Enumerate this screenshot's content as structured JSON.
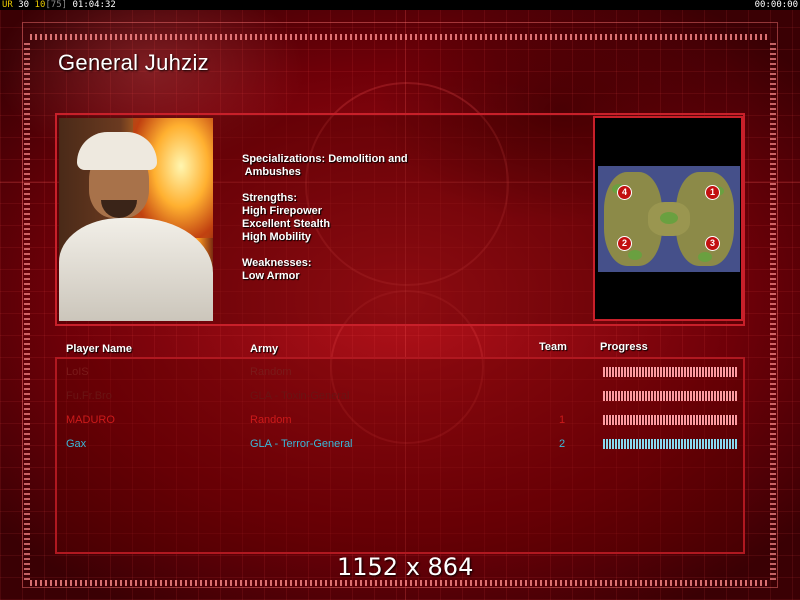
{
  "topbar": {
    "label_ur": "UR",
    "n1": "30",
    "n2": "10",
    "n3": "[75]",
    "time_left": "01:04:32",
    "time_right": "00:00:00"
  },
  "general": {
    "name": "General Juhziz",
    "specializations": "Specializations: Demolition and\n Ambushes",
    "strengths_title": "Strengths:",
    "strengths": [
      "High Firepower",
      "Excellent Stealth",
      "High Mobility"
    ],
    "weaknesses_title": "Weaknesses:",
    "weaknesses": [
      "Low Armor"
    ]
  },
  "minimap": {
    "start_positions": [
      "4",
      "1",
      "2",
      "3"
    ]
  },
  "table": {
    "headers": {
      "player": "Player Name",
      "army": "Army",
      "team": "Team",
      "progress": "Progress"
    },
    "rows": [
      {
        "player": "LoIS",
        "army": "Random",
        "team": "",
        "progress": 1.0,
        "name_color": "#7a1a1a",
        "bar_color": "#ff9aa0"
      },
      {
        "player": "Fu.Fr.Bro",
        "army": "GLA - Toxin-General",
        "team": "",
        "progress": 1.0,
        "name_color": "#6a1414",
        "bar_color": "#ff9aa0"
      },
      {
        "player": "MADURO",
        "army": "Random",
        "team": "1",
        "progress": 1.0,
        "name_color": "#cc1a1a",
        "bar_color": "#ff9aa0"
      },
      {
        "player": "Gax",
        "army": "GLA - Terror-General",
        "team": "2",
        "progress": 1.0,
        "name_color": "#3ab8d8",
        "bar_color": "#8ad8f0"
      }
    ]
  },
  "resolution": "1152 x 864"
}
